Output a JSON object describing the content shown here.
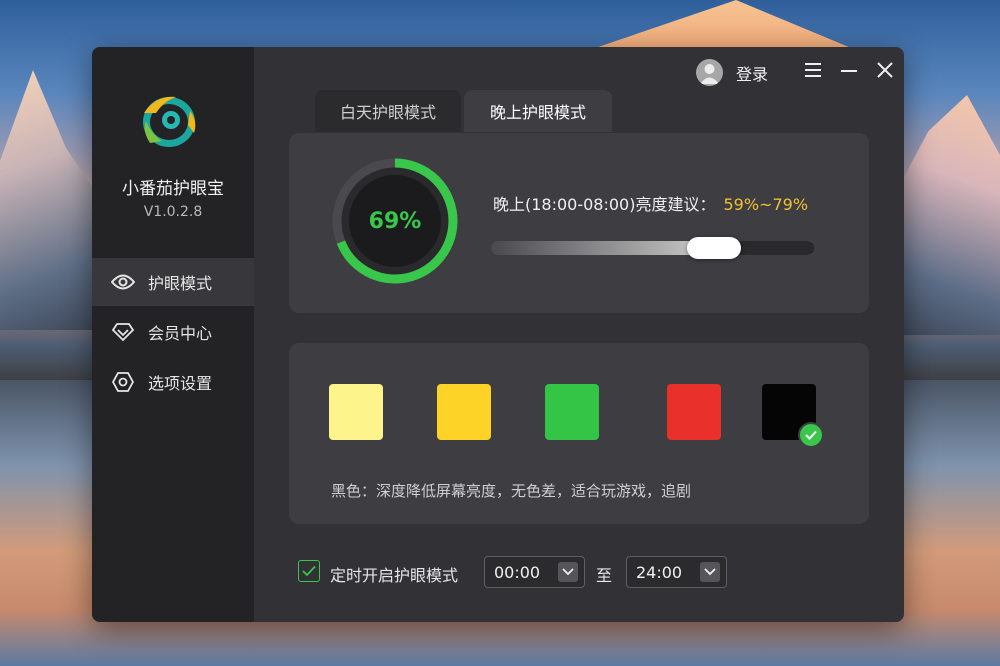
{
  "app": {
    "name": "小番茄护眼宝",
    "version": "V1.0.2.8"
  },
  "sidebar": {
    "items": [
      {
        "label": "护眼模式",
        "icon": "eye-icon",
        "active": true
      },
      {
        "label": "会员中心",
        "icon": "diamond-icon",
        "active": false
      },
      {
        "label": "选项设置",
        "icon": "hexagon-settings-icon",
        "active": false
      }
    ]
  },
  "topbar": {
    "login_label": "登录",
    "icons": [
      "user-avatar-icon",
      "menu-icon",
      "minimize-icon",
      "close-icon"
    ]
  },
  "tabs": [
    {
      "label": "白天护眼模式",
      "active": false
    },
    {
      "label": "晚上护眼模式",
      "active": true
    }
  ],
  "brightness": {
    "percent_label": "69%",
    "percent_value": 69,
    "suggestion_label": "晚上(18:00-08:00)亮度建议：",
    "suggestion_range": "59%~79%",
    "slider_value": 0.69
  },
  "colors": {
    "swatches": [
      {
        "name": "light-yellow",
        "hex": "#fdf58c"
      },
      {
        "name": "yellow",
        "hex": "#fdd327"
      },
      {
        "name": "green",
        "hex": "#35c546"
      },
      {
        "name": "red",
        "hex": "#ea302a"
      },
      {
        "name": "black",
        "hex": "#050505",
        "selected": true
      }
    ],
    "description": "黑色：深度降低屏幕亮度，无色差，适合玩游戏，追剧"
  },
  "timer": {
    "enabled": true,
    "label": "定时开启护眼模式",
    "start": "00:00",
    "to_label": "至",
    "end": "24:00"
  },
  "accent": {
    "green": "#38c74a",
    "gold": "#f3c02f"
  }
}
